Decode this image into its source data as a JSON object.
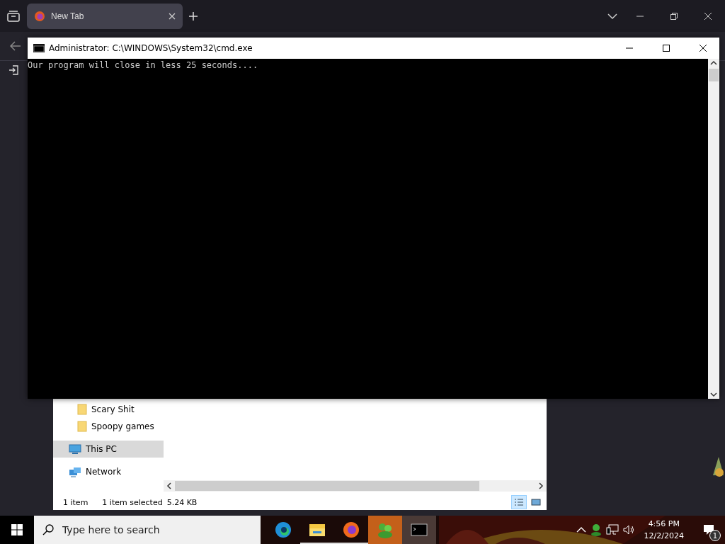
{
  "browser": {
    "tabs": [
      {
        "title": "New Tab",
        "selected": true
      }
    ]
  },
  "cmd_window": {
    "title": "Administrator: C:\\WINDOWS\\System32\\cmd.exe",
    "output": "Our program will close in less 25 seconds...."
  },
  "explorer": {
    "nav_items": [
      {
        "label": "Scary Shit",
        "kind": "folder",
        "selected": false
      },
      {
        "label": "Spoopy games",
        "kind": "folder",
        "selected": false
      },
      {
        "label": "This PC",
        "kind": "pc",
        "selected": true
      },
      {
        "label": "Network",
        "kind": "network",
        "selected": false
      }
    ],
    "status": {
      "item_count": "1 item",
      "selection": "1 item selected",
      "size": "5.24 KB"
    },
    "views": [
      {
        "kind": "details",
        "selected": true
      },
      {
        "kind": "large",
        "selected": false
      }
    ]
  },
  "taskbar": {
    "search": {
      "placeholder": "Type here to search"
    },
    "apps": [
      {
        "kind": "edge",
        "running": false,
        "highlighted": false,
        "selected": false
      },
      {
        "kind": "explorer",
        "running": true,
        "highlighted": false,
        "selected": false
      },
      {
        "kind": "firefox",
        "running": true,
        "highlighted": false,
        "selected": false
      },
      {
        "kind": "chat",
        "running": false,
        "highlighted": true,
        "selected": false
      },
      {
        "kind": "cmd",
        "running": false,
        "highlighted": false,
        "selected": true
      }
    ],
    "clock": {
      "time": "4:56 PM",
      "date": "12/2/2024"
    },
    "notifications": {
      "count": "1"
    }
  }
}
